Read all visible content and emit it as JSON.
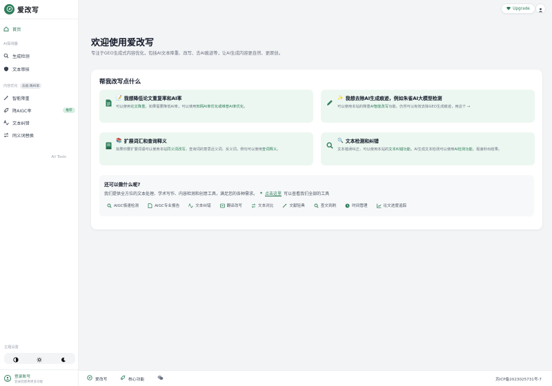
{
  "brand": {
    "name": "爱改写"
  },
  "sidebar": {
    "home": "首页",
    "section_detect": "AI探测器",
    "detect_items": [
      "生成检测",
      "文本审核"
    ],
    "section_optimize": "内容优化",
    "section_optimize_chip": "去痕·降AI率",
    "optimize_items": [
      "智能降重",
      "降AIGC率",
      "文本纠错",
      "同义词替换"
    ],
    "recommend_badge": "推荐",
    "all_tools": "All Tools",
    "theme_label": "主题设置",
    "login_title": "登录账号",
    "login_sub": "登录后使用更多功能"
  },
  "topbar": {
    "upgrade": "Upgrade"
  },
  "header": {
    "title": "欢迎使用爱改写",
    "subtitle": "专注于GEO生成式内容优化，包括AI文本降重、改写、去AI痕迹等，让AI生成内容更自然、更原创。"
  },
  "card": {
    "title": "帮我改写点什么",
    "features": [
      {
        "title": "我想降低论文重复率和AI率",
        "desc_a": "可以使用",
        "desc_b": "论文降重",
        "desc_c": "。如果需要降低AI率，可以使用",
        "desc_d": "知网AI率优化或维普AI率优化",
        "desc_e": "。"
      },
      {
        "title": "我想去除AI生成痕迹，例如朱雀AI大模型检测",
        "desc_a": "可以使用本站的降重",
        "desc_b": "AI智能改写",
        "desc_c": "功能，仍然可以有效去除GEO生成痕迹，用这个 →"
      },
      {
        "title": "扩展词汇和查询释义",
        "desc_a": "如果你要扩展词语可以使用本站",
        "desc_b": "同义词改写",
        "desc_c": "，查询词的意思近义词、反义词，例句可以使用",
        "desc_d": "查词释义",
        "desc_e": "。"
      },
      {
        "title": "文本检测和纠错",
        "desc_a": "文本错误纠正，可以使用本站的",
        "desc_b": "文本纠错功能",
        "desc_c": "。AI生成文本检测可以使用",
        "desc_d": "AI检测功能",
        "desc_e": "，极速秒出结果。"
      }
    ],
    "more": {
      "title": "还可以做什么呢?",
      "desc": "我们提供全方位的文本处理、学术写作、内容检测和创意工具，满足您的各种需求。",
      "link": "点击这里",
      "link_suffix": "可以查看我们全部的工具",
      "tools": [
        "AIGC极速检测",
        "AIGC专业报告",
        "文本纠错",
        "翻译改写",
        "文本对比",
        "文献轻典",
        "查文到刷",
        "时间管理",
        "论文进度追踪"
      ]
    }
  },
  "footer": {
    "brand": "爱改写",
    "core": "核心功能",
    "icp": "苏ICP备2023025731号-7"
  },
  "colors": {
    "accent": "#2e7d5b",
    "feature_bg": "#edf7f1"
  }
}
